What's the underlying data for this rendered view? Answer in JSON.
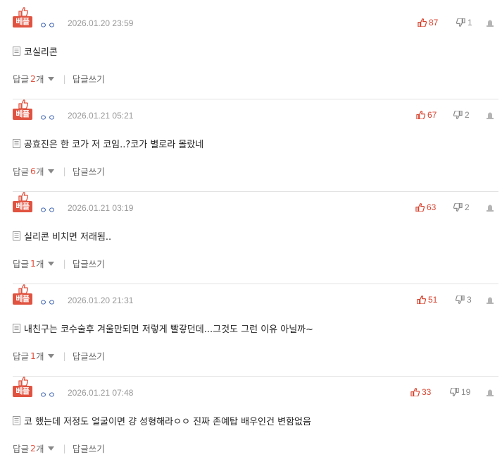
{
  "comments": [
    {
      "badge": "베플",
      "nick": "ㅇㅇ",
      "date": "2026.01.20 23:59",
      "likes": "87",
      "dislikes": "1",
      "text": "코실리콘",
      "reply_label": "답글",
      "reply_count": "2",
      "reply_unit": "개",
      "write_label": "답글쓰기"
    },
    {
      "badge": "베플",
      "nick": "ㅇㅇ",
      "date": "2026.01.21 05:21",
      "likes": "67",
      "dislikes": "2",
      "text": "공효진은 한 코가 저 코임..?코가 별로라 몰랐네",
      "reply_label": "답글",
      "reply_count": "6",
      "reply_unit": "개",
      "write_label": "답글쓰기"
    },
    {
      "badge": "베플",
      "nick": "ㅇㅇ",
      "date": "2026.01.21 03:19",
      "likes": "63",
      "dislikes": "2",
      "text": "실리콘 비치면 저래됨..",
      "reply_label": "답글",
      "reply_count": "1",
      "reply_unit": "개",
      "write_label": "답글쓰기"
    },
    {
      "badge": "베플",
      "nick": "ㅇㅇ",
      "date": "2026.01.20 21:31",
      "likes": "51",
      "dislikes": "3",
      "text": "내친구는 코수술후 겨울만되면 저렇게 빨갛던데...그것도 그런 이유 아닐까~",
      "reply_label": "답글",
      "reply_count": "1",
      "reply_unit": "개",
      "write_label": "답글쓰기"
    },
    {
      "badge": "베플",
      "nick": "ㅇㅇ",
      "date": "2026.01.21 07:48",
      "likes": "33",
      "dislikes": "19",
      "text": "코 했는데 저정도 얼굴이면 걍 성형해라ㅇㅇ 진짜 존예탑 배우인건 변함없음",
      "reply_label": "답글",
      "reply_count": "2",
      "reply_unit": "개",
      "write_label": "답글쓰기"
    }
  ],
  "colors": {
    "accent": "#e05340",
    "nick": "#3a5fae",
    "meta": "#999999",
    "divider": "#e3e3e3"
  },
  "icons": {
    "badge_icon": "thumbs-up-icon",
    "like_icon": "thumbs-up-icon",
    "dislike_icon": "thumbs-down-icon",
    "report_icon": "alarm-bell-icon",
    "memo_icon": "memo-icon",
    "caret_icon": "chevron-down-icon"
  }
}
